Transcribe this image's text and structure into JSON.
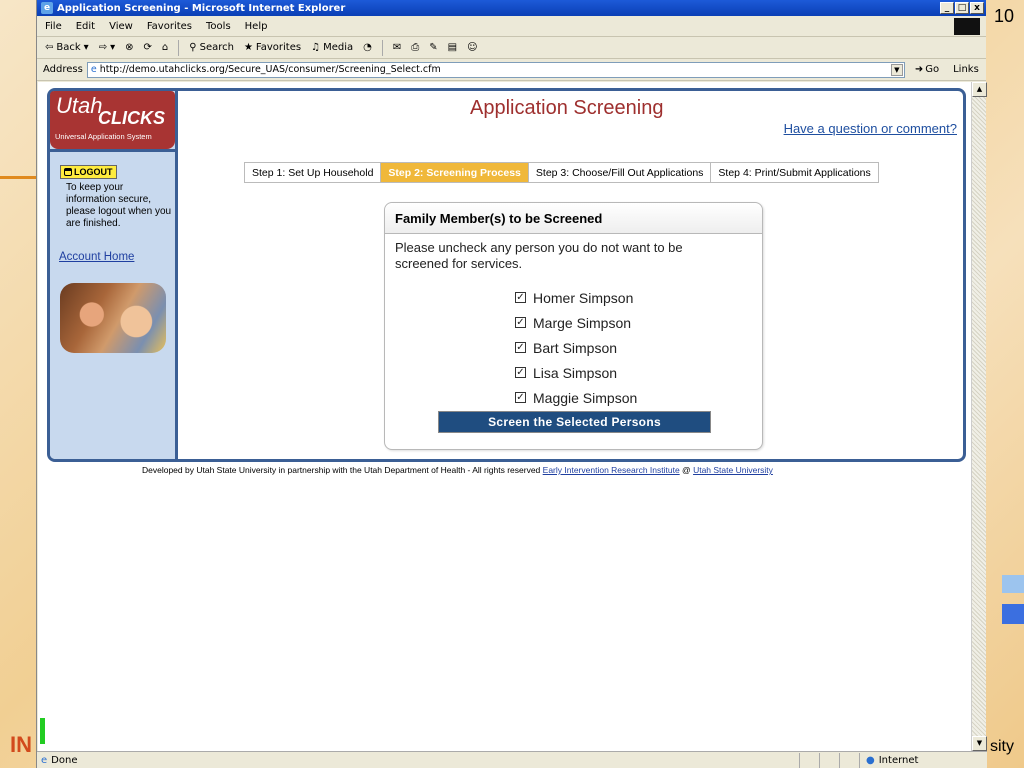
{
  "slide": {
    "page_number": "10",
    "left_text": "IN",
    "right_text": "sity"
  },
  "window": {
    "title": "Application Screening - Microsoft Internet Explorer",
    "controls": [
      "_",
      "□",
      "x"
    ]
  },
  "menu": {
    "items": [
      "File",
      "Edit",
      "View",
      "Favorites",
      "Tools",
      "Help"
    ]
  },
  "toolbar": {
    "back_label": "Back",
    "search_label": "Search",
    "favorites_label": "Favorites",
    "media_label": "Media"
  },
  "address": {
    "label": "Address",
    "url": "http://demo.utahclicks.org/Secure_UAS/consumer/Screening_Select.cfm",
    "go_label": "Go",
    "links_label": "Links"
  },
  "logo": {
    "utah": "Utah",
    "clicks": "CLICKS",
    "subtitle": "Universal Application System"
  },
  "sidebar": {
    "logout_label": "LOGOUT",
    "secure_note": "To keep your information secure, please logout when you are finished.",
    "account_home": "Account Home"
  },
  "page": {
    "title": "Application Screening",
    "question_link": "Have a question or comment?"
  },
  "steps": [
    {
      "label": "Step 1: Set Up Household",
      "active": false
    },
    {
      "label": "Step 2: Screening Process",
      "active": true
    },
    {
      "label": "Step 3: Choose/Fill Out Applications",
      "active": false
    },
    {
      "label": "Step 4: Print/Submit Applications",
      "active": false
    }
  ],
  "panel": {
    "heading": "Family Member(s) to be Screened",
    "instructions": "Please uncheck any person you do not want to be screened for services.",
    "members": [
      {
        "name": "Homer Simpson",
        "checked": true
      },
      {
        "name": "Marge Simpson",
        "checked": true
      },
      {
        "name": "Bart Simpson",
        "checked": true
      },
      {
        "name": "Lisa Simpson",
        "checked": true
      },
      {
        "name": "Maggie Simpson",
        "checked": true
      }
    ],
    "submit_label": "Screen the Selected Persons"
  },
  "footer": {
    "text": "Developed by Utah State University in partnership with the Utah Department of Health   -   All rights reserved",
    "link1": "Early Intervention Research Institute",
    "at": "@",
    "link2": "Utah State University"
  },
  "status": {
    "text": "Done",
    "zone": "Internet"
  },
  "colors": {
    "frame": "#3b5f95",
    "brand_red": "#a83433",
    "active_step": "#f0b83a",
    "button": "#1f4d80",
    "link": "#1f4fa0"
  }
}
